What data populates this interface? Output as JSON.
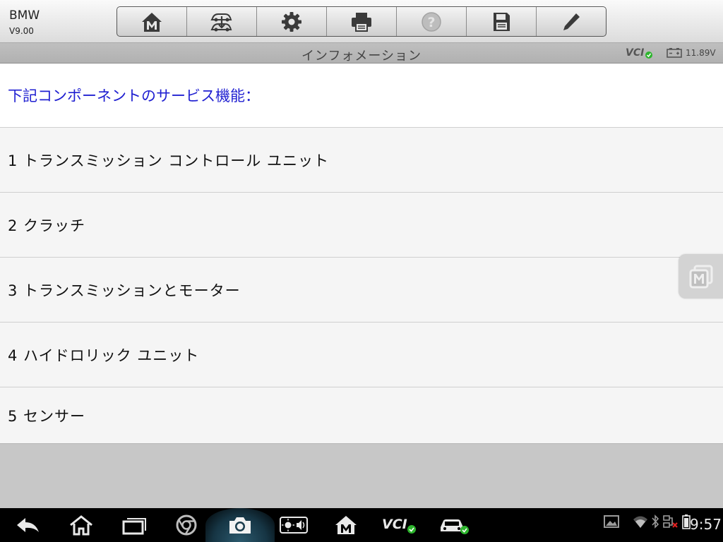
{
  "header": {
    "app_name": "BMW",
    "version": "V9.00"
  },
  "toolbar": {
    "buttons": [
      {
        "name": "home",
        "icon": "home-icon"
      },
      {
        "name": "vehicle-swap",
        "icon": "vehicle-swap-icon"
      },
      {
        "name": "settings",
        "icon": "gear-icon"
      },
      {
        "name": "print",
        "icon": "printer-icon"
      },
      {
        "name": "help",
        "icon": "help-icon"
      },
      {
        "name": "save",
        "icon": "floppy-icon"
      },
      {
        "name": "edit",
        "icon": "pencil-icon"
      }
    ]
  },
  "titlebar": {
    "title": "インフォメーション",
    "vci_label": "VCI",
    "voltage": "11.89V"
  },
  "content": {
    "header_text": "下記コンポーネントのサービス機能：",
    "items": [
      {
        "label": "1 トランスミッション コントロール ユニット"
      },
      {
        "label": "2 クラッチ"
      },
      {
        "label": "3 トランスミッションとモーター"
      },
      {
        "label": "4 ハイドロリック ユニット"
      },
      {
        "label": "5 センサー"
      }
    ]
  },
  "system_bar": {
    "vci_label": "VCI",
    "clock": "9:57"
  },
  "colors": {
    "header_text": "#1f1fd1",
    "status_ok": "#2db52d"
  }
}
